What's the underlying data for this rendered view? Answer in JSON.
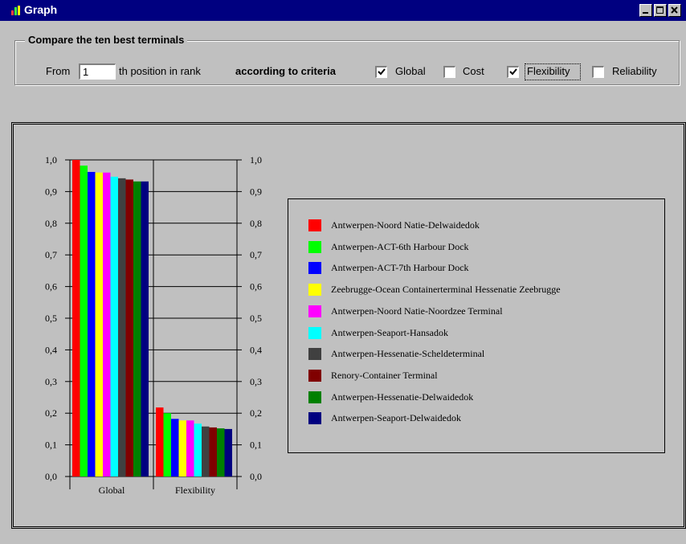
{
  "window": {
    "title": "Graph"
  },
  "controls": {
    "group_title": "Compare the ten best terminals",
    "from_label": "From",
    "rank_value": "1",
    "position_label": "th position in rank",
    "criteria_label": "according to criteria",
    "criteria": [
      {
        "label": "Global",
        "checked": true
      },
      {
        "label": "Cost",
        "checked": false
      },
      {
        "label": "Flexibility",
        "checked": true
      },
      {
        "label": "Reliability",
        "checked": false
      }
    ]
  },
  "chart_data": {
    "type": "bar",
    "categories": [
      "Global",
      "Flexibility"
    ],
    "ylim": [
      0,
      1
    ],
    "yticks": [
      "0,0",
      "0,1",
      "0,2",
      "0,3",
      "0,4",
      "0,5",
      "0,6",
      "0,7",
      "0,8",
      "0,9",
      "1,0"
    ],
    "grid": true,
    "legend_position": "right",
    "series": [
      {
        "name": "Antwerpen-Noord Natie-Delwaidedok",
        "color": "#ff0000",
        "values": [
          1.0,
          0.218
        ]
      },
      {
        "name": "Antwerpen-ACT-6th Harbour Dock",
        "color": "#00ff00",
        "values": [
          0.982,
          0.2
        ]
      },
      {
        "name": "Antwerpen-ACT-7th Harbour Dock",
        "color": "#0000ff",
        "values": [
          0.962,
          0.182
        ]
      },
      {
        "name": "Zeebrugge-Ocean Containerterminal Hessenatie Zeebrugge",
        "color": "#ffff00",
        "values": [
          0.96,
          0.177
        ]
      },
      {
        "name": "Antwerpen-Noord Natie-Noordzee Terminal",
        "color": "#ff00ff",
        "values": [
          0.96,
          0.177
        ]
      },
      {
        "name": "Antwerpen-Seaport-Hansadok",
        "color": "#00ffff",
        "values": [
          0.947,
          0.167
        ]
      },
      {
        "name": "Antwerpen-Hessenatie-Scheldeterminal",
        "color": "#404040",
        "values": [
          0.942,
          0.158
        ]
      },
      {
        "name": "Renory-Container Terminal",
        "color": "#800000",
        "values": [
          0.938,
          0.155
        ]
      },
      {
        "name": "Antwerpen-Hessenatie-Delwaidedok",
        "color": "#008000",
        "values": [
          0.932,
          0.152
        ]
      },
      {
        "name": "Antwerpen-Seaport-Delwaidedok",
        "color": "#000080",
        "values": [
          0.932,
          0.15
        ]
      }
    ]
  }
}
